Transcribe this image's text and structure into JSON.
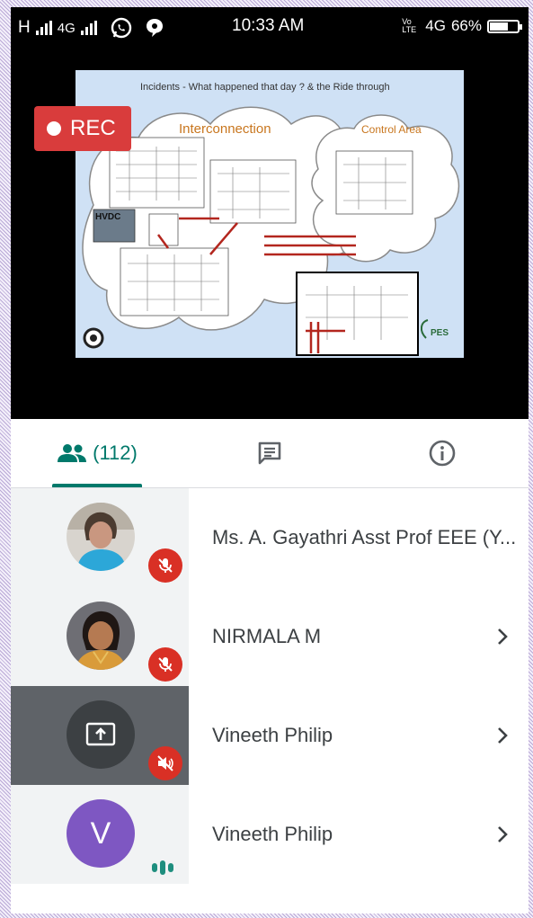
{
  "status_bar": {
    "left_text": "H",
    "network_1": "4G",
    "time": "10:33 AM",
    "lte_label": "Vo LTE",
    "network_2": "4G",
    "battery": "66%",
    "battery_level": 0.66
  },
  "recording": {
    "label": "REC"
  },
  "slide": {
    "title": "Incidents - What happened that day ? & the Ride through",
    "interconnection": "Interconnection",
    "control_area": "Control Area",
    "hvdc": "HVDC",
    "logo_text": "PES"
  },
  "tabs": {
    "people_count": "(112)"
  },
  "participants": [
    {
      "name": "Ms. A. Gayathri Asst Prof EEE (Y..."
    },
    {
      "name": "NIRMALA M"
    },
    {
      "name": "Vineeth Philip"
    },
    {
      "name": "Vineeth Philip",
      "initial": "V"
    }
  ],
  "colors": {
    "accent": "#00796b",
    "rec": "#d93c3c",
    "mute_badge": "#d93025",
    "avatar_v": "#7e57c2"
  }
}
